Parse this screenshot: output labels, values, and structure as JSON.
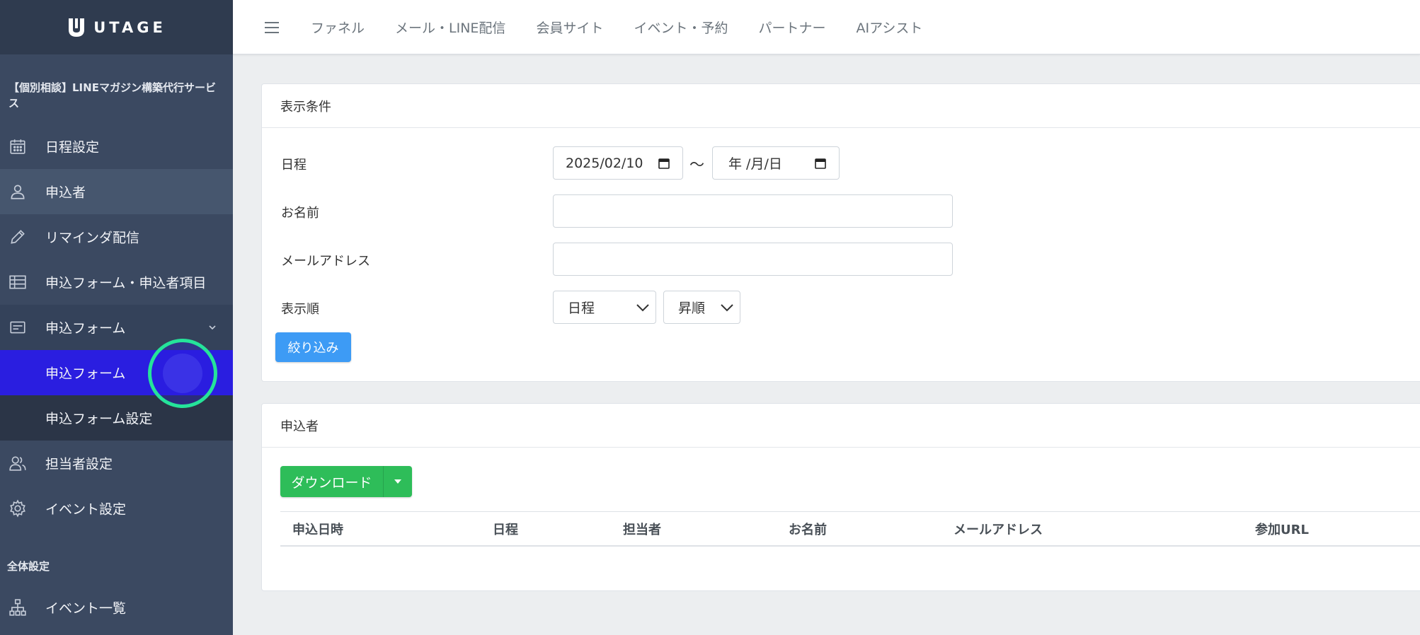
{
  "brand": {
    "logo_text": "UTAGE"
  },
  "sidebar": {
    "project_title": "【個別相談】LINEマガジン構築代行サービス",
    "items": [
      {
        "label": "日程設定",
        "icon": "calendar-icon"
      },
      {
        "label": "申込者",
        "icon": "user-icon"
      },
      {
        "label": "リマインダ配信",
        "icon": "pencil-icon"
      },
      {
        "label": "申込フォーム・申込者項目",
        "icon": "table-icon"
      },
      {
        "label": "申込フォーム",
        "icon": "form-icon"
      },
      {
        "label": "申込フォーム"
      },
      {
        "label": "申込フォーム設定"
      },
      {
        "label": "担当者設定",
        "icon": "users-icon"
      },
      {
        "label": "イベント設定",
        "icon": "gear-icon"
      }
    ],
    "section_label": "全体設定",
    "bottom_item": {
      "label": "イベント一覧",
      "icon": "sitemap-icon"
    }
  },
  "topbar": {
    "nav": [
      "ファネル",
      "メール・LINE配信",
      "会員サイト",
      "イベント・予約",
      "パートナー",
      "AIアシスト"
    ]
  },
  "filter": {
    "title": "表示条件",
    "schedule_label": "日程",
    "date_from": "2025/02/10",
    "tilde": "〜",
    "date_to_placeholder": "年 /月/日",
    "name_label": "お名前",
    "name_value": "",
    "email_label": "メールアドレス",
    "email_value": "",
    "order_label": "表示順",
    "order_field": "日程",
    "order_direction": "昇順",
    "submit": "絞り込み"
  },
  "applicants": {
    "title": "申込者",
    "download": "ダウンロード",
    "columns": [
      "申込日時",
      "日程",
      "担当者",
      "お名前",
      "メールアドレス",
      "参加URL"
    ]
  },
  "colors": {
    "sidebar_bg": "#3b4961",
    "active_item": "#2a1ee0",
    "primary": "#3d9bf5",
    "success": "#2ebd59",
    "click_ring": "#25e39a"
  }
}
